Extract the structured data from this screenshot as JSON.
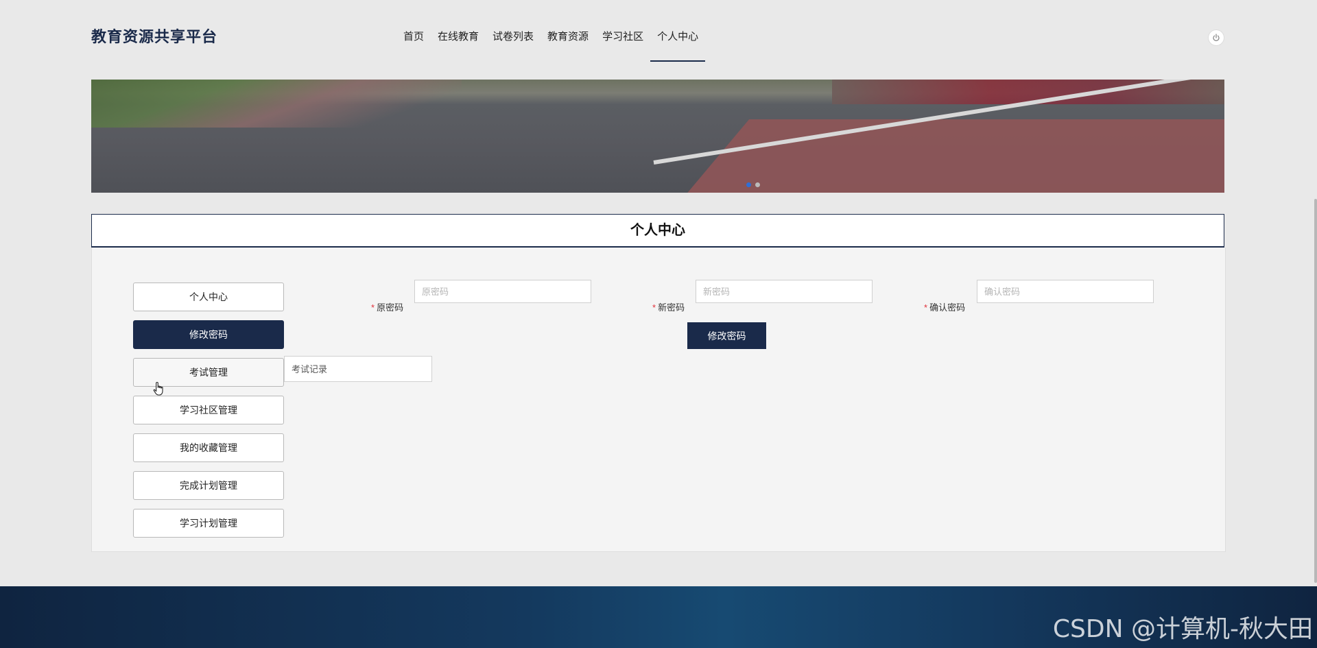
{
  "header": {
    "logo": "教育资源共享平台",
    "nav": [
      {
        "label": "首页"
      },
      {
        "label": "在线教育"
      },
      {
        "label": "试卷列表"
      },
      {
        "label": "教育资源"
      },
      {
        "label": "学习社区"
      },
      {
        "label": "个人中心",
        "active": true
      }
    ],
    "power_icon": "power-icon"
  },
  "banner": {
    "carousel_active_index": 0,
    "carousel_count": 2
  },
  "section": {
    "title": "个人中心"
  },
  "sidebar": {
    "items": [
      {
        "label": "个人中心"
      },
      {
        "label": "修改密码",
        "active": true
      },
      {
        "label": "考试管理"
      },
      {
        "label": "学习社区管理"
      },
      {
        "label": "我的收藏管理"
      },
      {
        "label": "完成计划管理"
      },
      {
        "label": "学习计划管理"
      }
    ],
    "submenu": {
      "label": "考试记录"
    }
  },
  "form": {
    "old_password": {
      "label": "原密码",
      "placeholder": "原密码",
      "value": ""
    },
    "new_password": {
      "label": "新密码",
      "placeholder": "新密码",
      "value": ""
    },
    "confirm_password": {
      "label": "确认密码",
      "placeholder": "确认密码",
      "value": ""
    },
    "required_mark": "*",
    "submit_label": "修改密码"
  },
  "footer": {
    "watermark": "CSDN @计算机-秋大田"
  },
  "colors": {
    "primary": "#1a2a4a",
    "required": "#e0303a",
    "carousel_active": "#2f6fd6"
  }
}
